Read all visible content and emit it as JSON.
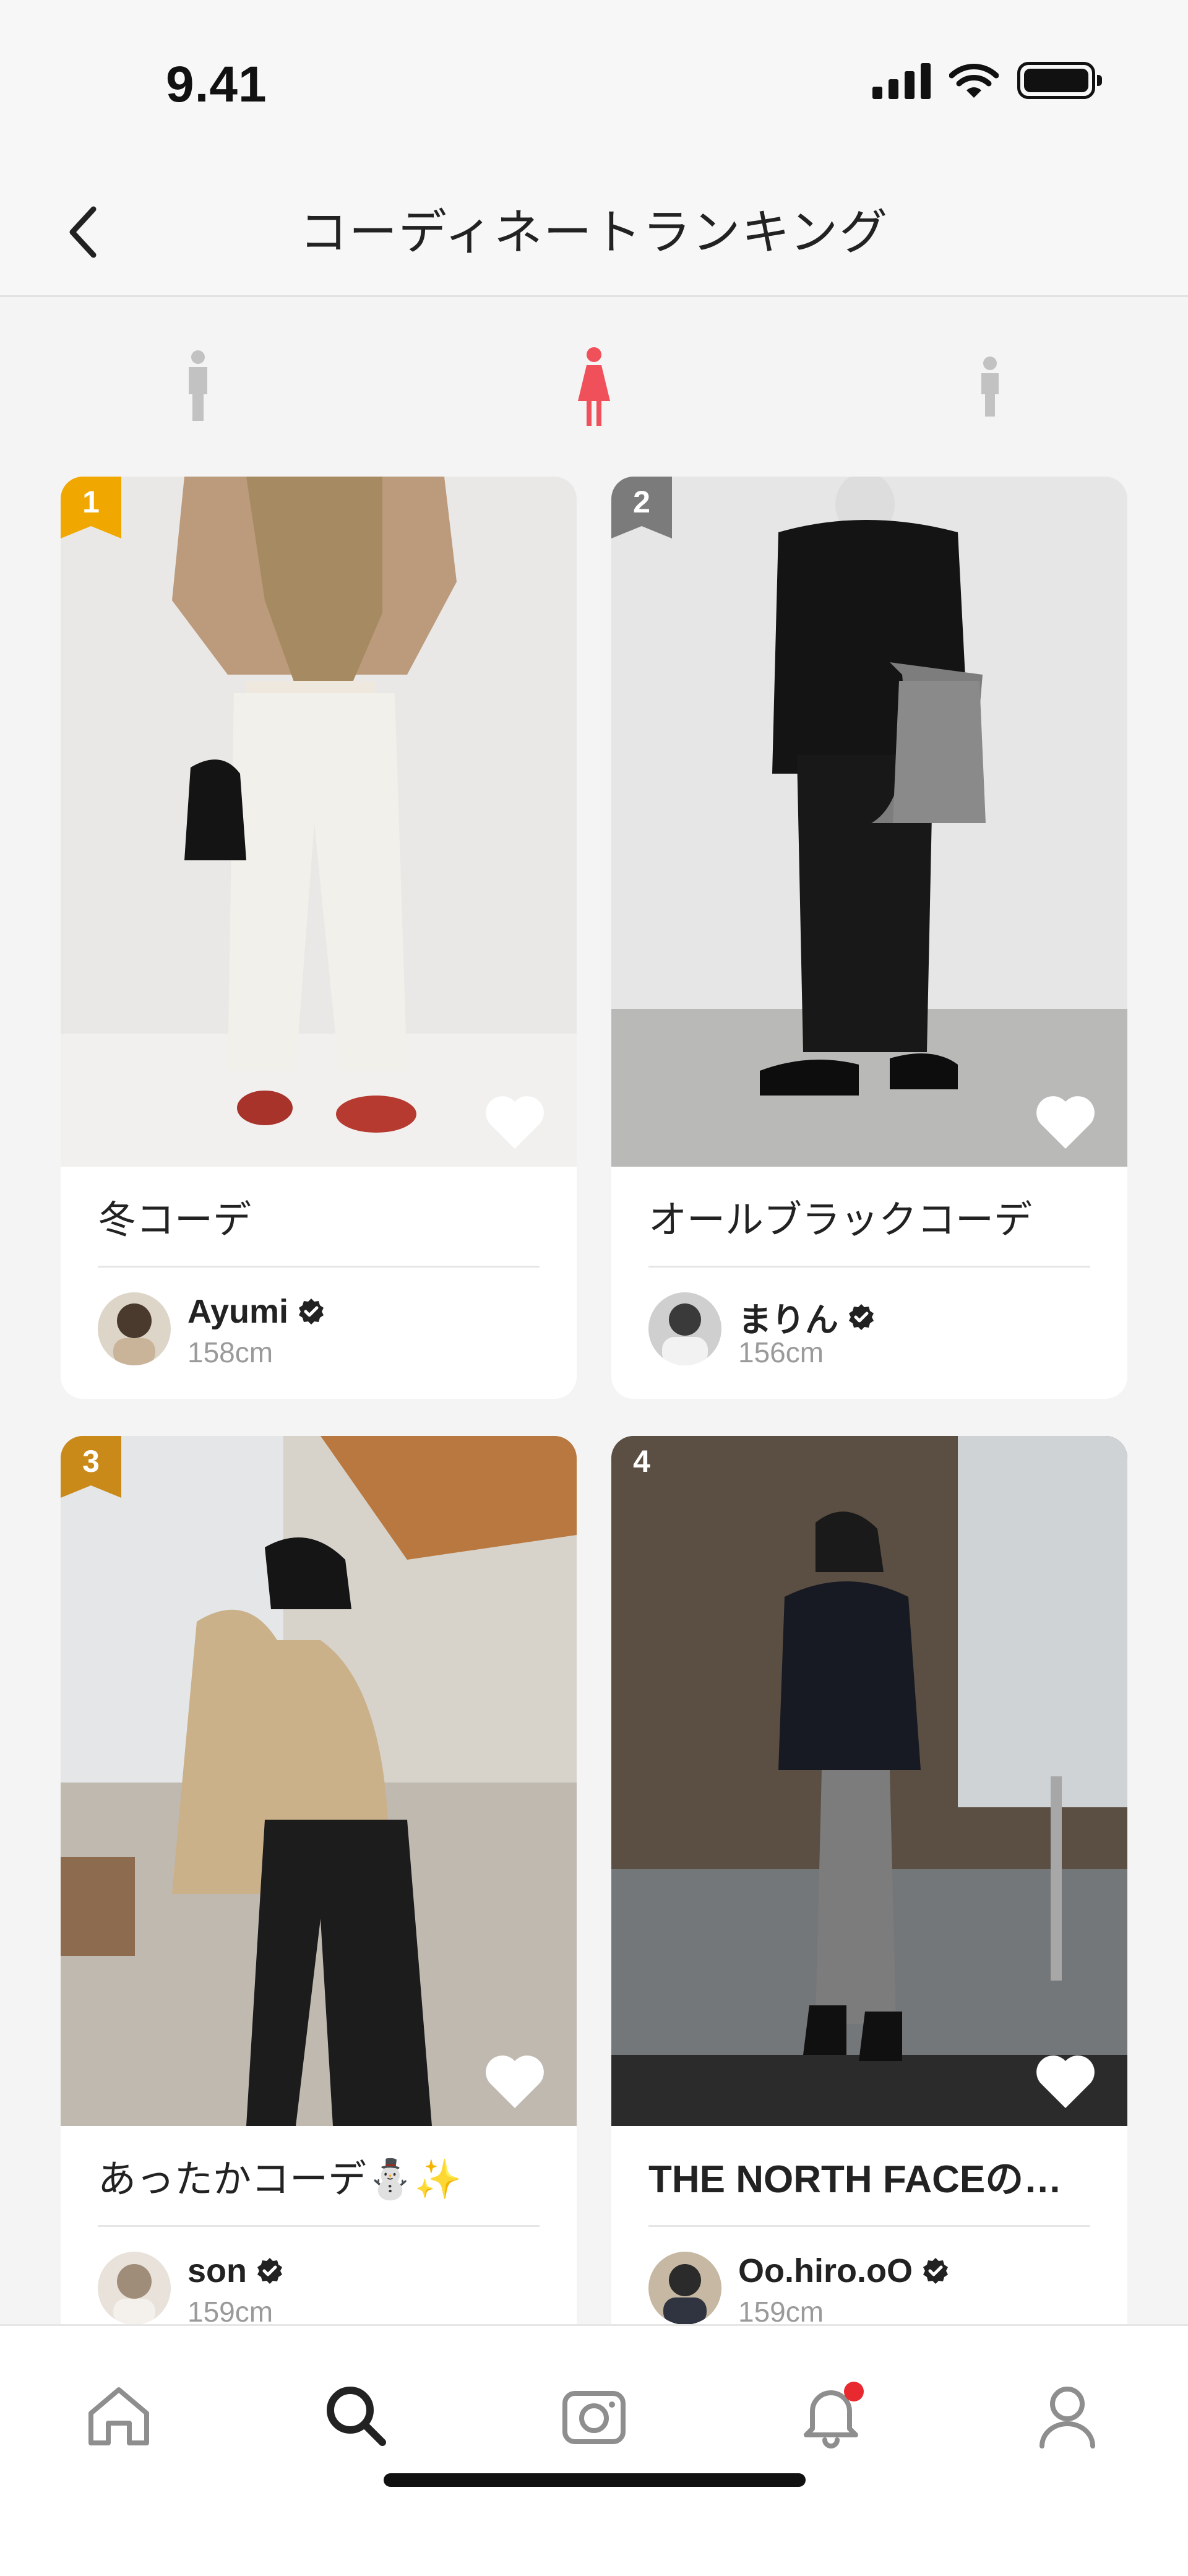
{
  "status_bar": {
    "time": "9.41"
  },
  "header": {
    "title": "コーディネートランキング"
  },
  "gender_tabs": [
    {
      "name": "men",
      "selected": false
    },
    {
      "name": "women",
      "selected": true
    },
    {
      "name": "kids",
      "selected": false
    }
  ],
  "colors": {
    "accent": "#f0505a",
    "rank_gold": "#f0a800",
    "rank_silver": "#7b7b7b",
    "rank_bronze": "#c98a1a",
    "notification_dot": "#e8292f"
  },
  "cards": [
    {
      "rank": "1",
      "title": "冬コーデ",
      "user": "Ayumi",
      "height": "158cm",
      "verified": true
    },
    {
      "rank": "2",
      "title": "オールブラックコーデ",
      "user": "まりん",
      "height": "156cm",
      "verified": true
    },
    {
      "rank": "3",
      "title": "あったかコーデ⛄✨",
      "user": "son",
      "height": "159cm",
      "verified": true
    },
    {
      "rank": "4",
      "title": "THE NORTH FACEの…",
      "user": "Oo.hiro.oO",
      "height": "159cm",
      "verified": true
    }
  ],
  "tab_bar": {
    "items": [
      {
        "name": "home",
        "icon": "home-icon",
        "selected": false
      },
      {
        "name": "search",
        "icon": "search-icon",
        "selected": true
      },
      {
        "name": "camera",
        "icon": "camera-icon",
        "selected": false
      },
      {
        "name": "notifications",
        "icon": "bell-icon",
        "selected": false,
        "badge": true
      },
      {
        "name": "profile",
        "icon": "person-icon",
        "selected": false
      }
    ]
  }
}
